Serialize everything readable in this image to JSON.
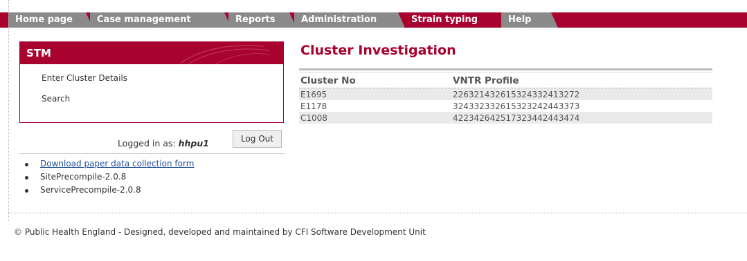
{
  "nav": {
    "tabs": [
      {
        "label": "Home page",
        "active": false
      },
      {
        "label": "Case management",
        "active": false
      },
      {
        "label": "Reports",
        "active": false
      },
      {
        "label": "Administration",
        "active": false
      },
      {
        "label": "Strain typing",
        "active": true
      },
      {
        "label": "Help",
        "active": false
      }
    ],
    "accent_color": "#a8022e",
    "inactive_color": "#8a8a8a"
  },
  "sidebar": {
    "title": "STM",
    "links": [
      "Enter Cluster Details",
      "Search"
    ],
    "logged_in_label": "Logged in as:",
    "username": "hhpu1",
    "logout_label": "Log Out",
    "bullet_items": [
      {
        "label": "Download paper data collection form",
        "is_link": true
      },
      {
        "label": "SitePrecompile-2.0.8",
        "is_link": false
      },
      {
        "label": "ServicePrecompile-2.0.8",
        "is_link": false
      }
    ]
  },
  "main": {
    "title": "Cluster Investigation",
    "table": {
      "headers": [
        "Cluster No",
        "VNTR Profile"
      ],
      "rows": [
        [
          "E1695",
          "226321432615324332413272"
        ],
        [
          "E1178",
          "324332332615323242443373"
        ],
        [
          "C1008",
          "422342642517323442443474"
        ]
      ]
    }
  },
  "footer": {
    "text": "© Public Health England - Designed, developed and maintained by CFI Software Development Unit"
  }
}
